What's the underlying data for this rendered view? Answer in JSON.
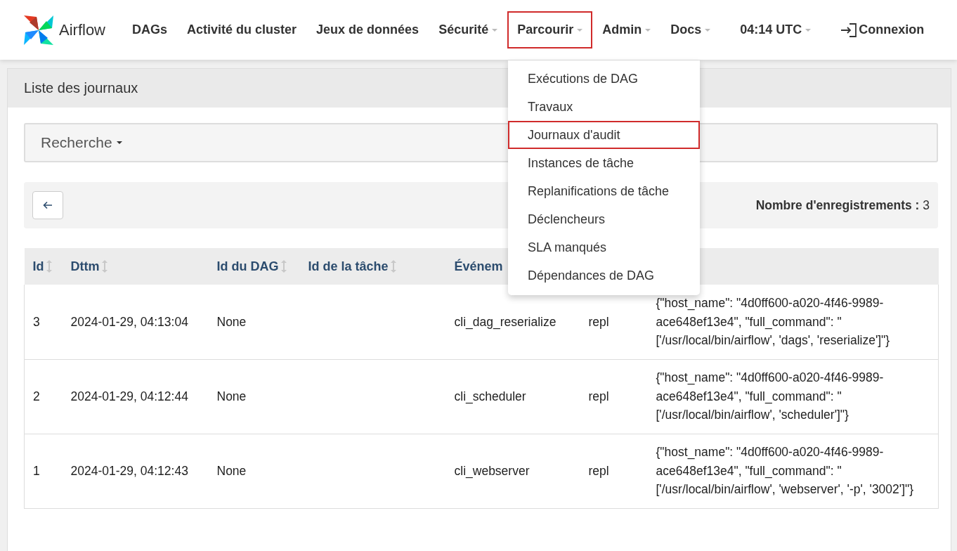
{
  "brand": "Airflow",
  "nav": [
    {
      "label": "DAGs",
      "dropdown": false,
      "highlighted": false
    },
    {
      "label": "Activité du cluster",
      "dropdown": false,
      "highlighted": false
    },
    {
      "label": "Jeux de données",
      "dropdown": false,
      "highlighted": false
    },
    {
      "label": "Sécurité",
      "dropdown": true,
      "highlighted": false
    },
    {
      "label": "Parcourir",
      "dropdown": true,
      "highlighted": true
    },
    {
      "label": "Admin",
      "dropdown": true,
      "highlighted": false
    },
    {
      "label": "Docs",
      "dropdown": true,
      "highlighted": false
    }
  ],
  "clock": "04:14 UTC",
  "login": "Connexion",
  "menu": [
    {
      "label": "Exécutions de DAG",
      "highlighted": false
    },
    {
      "label": "Travaux",
      "highlighted": false
    },
    {
      "label": "Journaux d'audit",
      "highlighted": true
    },
    {
      "label": "Instances de tâche",
      "highlighted": false
    },
    {
      "label": "Replanifications de tâche",
      "highlighted": false
    },
    {
      "label": "Déclencheurs",
      "highlighted": false
    },
    {
      "label": "SLA manqués",
      "highlighted": false
    },
    {
      "label": "Dépendances de DAG",
      "highlighted": false
    }
  ],
  "panel_title": "Liste des journaux",
  "search": "Recherche",
  "record_count": "**Nombre d'enregistrements :** 3",
  "table": {
    "columns": [
      {
        "label": "Id"
      },
      {
        "label": "Dttm"
      },
      {
        "label": "Id du DAG"
      },
      {
        "label": "Id de la tâche"
      },
      {
        "label": "Événem"
      },
      {},
      {}
    ],
    "rows": [
      {
        "cells": [
          "3",
          "2024-01-29, 04:13:04",
          "None",
          "",
          "cli_dag_reserialize",
          "repl",
          "{\"host_name\": \"4d0ff600-a020-4f46-9989-ace648ef13e4\", \"full_command\": \"['/usr/local/bin/airflow', 'dags', 'reserialize']\"}"
        ]
      },
      {
        "cells": [
          "2",
          "2024-01-29, 04:12:44",
          "None",
          "",
          "cli_scheduler",
          "repl",
          "{\"host_name\": \"4d0ff600-a020-4f46-9989-ace648ef13e4\", \"full_command\": \"['/usr/local/bin/airflow', 'scheduler']\"}"
        ]
      },
      {
        "cells": [
          "1",
          "2024-01-29, 04:12:43",
          "None",
          "",
          "cli_webserver",
          "repl",
          "{\"host_name\": \"4d0ff600-a020-4f46-9989-ace648ef13e4\", \"full_command\": \"['/usr/local/bin/airflow', 'webserver', '-p', '3002']\"}"
        ]
      }
    ]
  }
}
